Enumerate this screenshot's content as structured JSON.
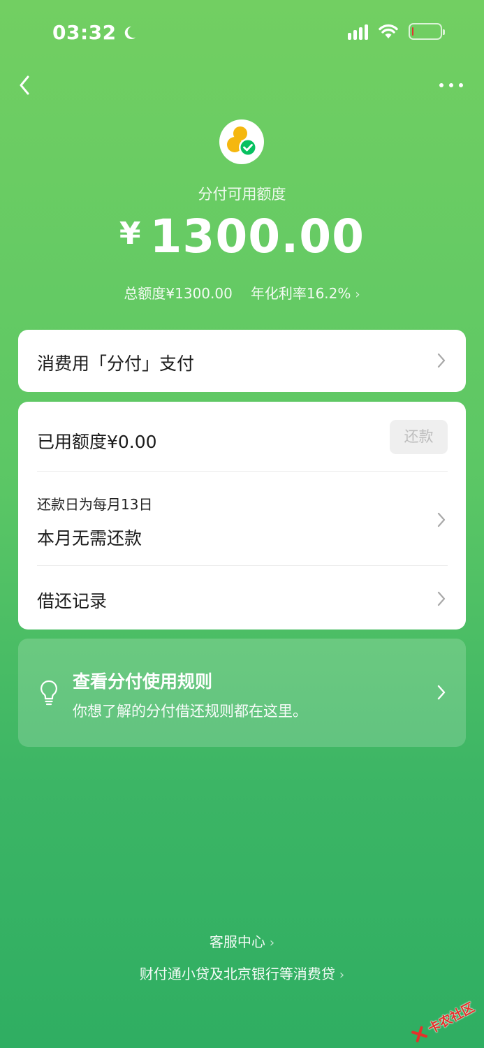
{
  "status_bar": {
    "time": "03:32",
    "icons": [
      "moon-icon",
      "signal-icon",
      "wifi-icon",
      "battery-icon"
    ],
    "battery_level_percent": 5,
    "battery_color": "#e3342f"
  },
  "nav": {
    "icons": [
      "back-icon",
      "more-icon"
    ]
  },
  "summary": {
    "label": "分付可用额度",
    "currency": "¥",
    "amount": "1300.00",
    "total_limit": "总额度¥1300.00",
    "annual_rate": "年化利率16.2%"
  },
  "pay_card": {
    "label": "消费用「分付」支付"
  },
  "debt_card": {
    "used": "已用额度¥0.00",
    "repay_button": "还款",
    "due_day": "还款日为每月13日",
    "due_status": "本月无需还款",
    "records": "借还记录"
  },
  "tips": {
    "title": "查看分付使用规则",
    "subtitle": "你想了解的分付借还规则都在这里。"
  },
  "footer": {
    "help": "客服中心",
    "lender": "财付通小贷及北京银行等消费贷"
  },
  "watermark": {
    "text": "卡农社区"
  },
  "colors": {
    "background_top": "#72cf62",
    "background_bottom": "#2fae62",
    "logo_yellow": "#f5b70f",
    "logo_green": "#07c160"
  }
}
